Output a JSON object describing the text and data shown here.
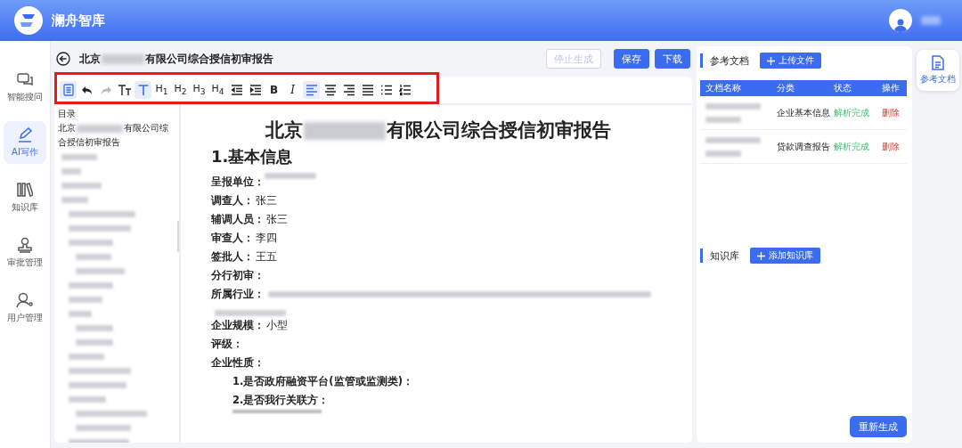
{
  "app": {
    "name": "澜舟智库"
  },
  "sidebar": {
    "items": [
      {
        "label": "智能搜问",
        "kind": "chat",
        "selected": false
      },
      {
        "label": "AI写作",
        "kind": "pen",
        "selected": true
      },
      {
        "label": "知识库",
        "kind": "books",
        "selected": false
      },
      {
        "label": "审批管理",
        "kind": "stamp",
        "selected": false
      },
      {
        "label": "用户管理",
        "kind": "user",
        "selected": false
      }
    ]
  },
  "document": {
    "title_prefix": "北京",
    "title_suffix": "有限公司综合授信初审报告",
    "buttons": [
      {
        "label": "停止生成",
        "disabled": true
      },
      {
        "label": "保存",
        "disabled": false
      },
      {
        "label": "下载",
        "disabled": false
      }
    ]
  },
  "toolbar": [
    {
      "kind": "doc",
      "selected": true,
      "disabled": false
    },
    {
      "kind": "undo",
      "selected": false,
      "disabled": false
    },
    {
      "kind": "redo",
      "selected": false,
      "disabled": true
    },
    {
      "kind": "font-size",
      "selected": false,
      "disabled": false
    },
    {
      "kind": "text",
      "selected": true,
      "disabled": false
    },
    {
      "kind": "heading",
      "label": "H$_{1}$",
      "selected": false,
      "disabled": false
    },
    {
      "kind": "heading",
      "label": "H$_{2}$",
      "selected": false,
      "disabled": false
    },
    {
      "kind": "heading",
      "label": "H$_{3}$",
      "selected": false,
      "disabled": false
    },
    {
      "kind": "heading",
      "label": "H$_{4}$",
      "selected": false,
      "disabled": false
    },
    {
      "kind": "outdent",
      "selected": false,
      "disabled": false
    },
    {
      "kind": "indent",
      "selected": false,
      "disabled": false
    },
    {
      "kind": "bold",
      "label": "B",
      "selected": false,
      "disabled": false
    },
    {
      "kind": "italic",
      "label": "I",
      "selected": false,
      "disabled": false
    },
    {
      "kind": "align-left",
      "selected": true,
      "disabled": false
    },
    {
      "kind": "align-center",
      "selected": false,
      "disabled": false
    },
    {
      "kind": "align-right",
      "selected": false,
      "disabled": false
    },
    {
      "kind": "justify",
      "selected": false,
      "disabled": false
    },
    {
      "kind": "bullets",
      "selected": false,
      "disabled": false
    },
    {
      "kind": "numbers",
      "selected": false,
      "disabled": false
    }
  ],
  "outline": {
    "heading": "目录",
    "title_prefix": "北京",
    "title_suffix": "有限公司综合授信初审报告"
  },
  "content": {
    "title_prefix": "北京",
    "title_suffix": "有限公司综合授信初审报告",
    "section": "1.基本信息",
    "fields": [
      {
        "label": "呈报单位：",
        "kind": "blurred"
      },
      {
        "label": "调查人：",
        "value": "张三",
        "kind": "text"
      },
      {
        "label": "辅调人员：",
        "value": "张三",
        "kind": "text"
      },
      {
        "label": "审查人：",
        "value": "李四",
        "kind": "text"
      },
      {
        "label": "签批人：",
        "value": "王五",
        "kind": "text"
      },
      {
        "label": "分行初审：",
        "kind": "empty"
      },
      {
        "label": "所属行业：",
        "kind": "blurred-long"
      },
      {
        "label": "企业规模：",
        "value": "小型",
        "kind": "text"
      },
      {
        "label": "评级：",
        "kind": "empty"
      },
      {
        "label": "企业性质：",
        "kind": "empty"
      }
    ],
    "sub_items": [
      "1.是否政府融资平台(监管或监测类)：",
      "2.是否我行关联方："
    ]
  },
  "reference": {
    "title": "参考文档",
    "upload": "上传文件",
    "columns": [
      "文档名称",
      "分类",
      "状态",
      "操作"
    ],
    "rows": [
      {
        "category": "企业基本信息",
        "status": "解析完成",
        "action": "删除"
      },
      {
        "category": "贷款调查报告",
        "status": "解析完成",
        "action": "删除"
      }
    ]
  },
  "knowledge": {
    "title": "知识库",
    "add": "添加知识库"
  },
  "regenerate": "重新生成",
  "side_tab": {
    "label": "参考文档",
    "selected": true
  }
}
